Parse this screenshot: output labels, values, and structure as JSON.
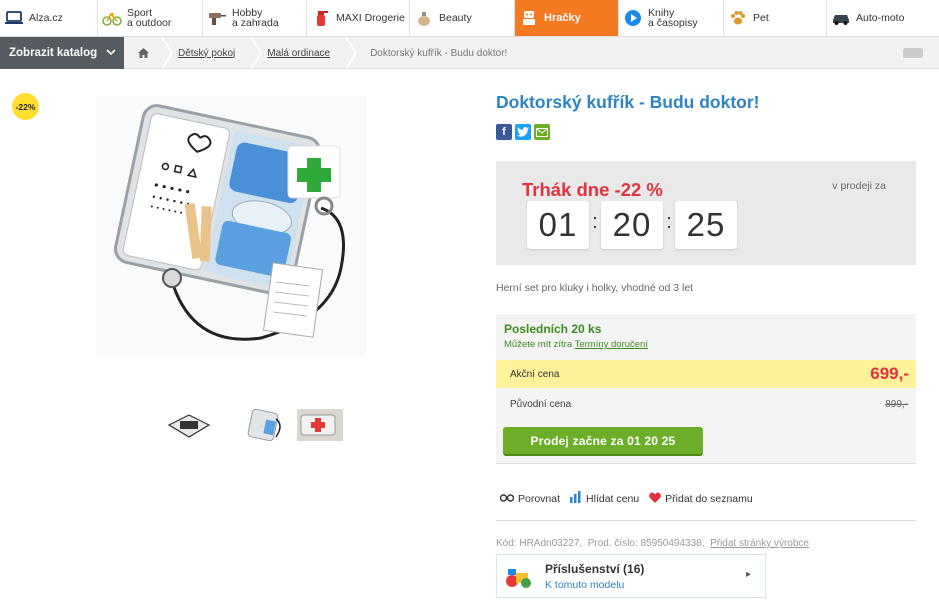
{
  "nav": {
    "categories": [
      {
        "label": "Alza.cz",
        "icon": "laptop-icon"
      },
      {
        "label": "Sport\na outdoor",
        "icon": "bicycle-icon"
      },
      {
        "label": "Hobby\na zahrada",
        "icon": "drill-icon"
      },
      {
        "label": "MAXI Drogerie",
        "icon": "spray-bottle-icon"
      },
      {
        "label": "Beauty",
        "icon": "perfume-icon"
      },
      {
        "label": "Hračky",
        "icon": "toy-robot-icon"
      },
      {
        "label": "Knihy\na časopisy",
        "icon": "play-icon"
      },
      {
        "label": "Pet",
        "icon": "paw-icon"
      },
      {
        "label": "Auto-moto",
        "icon": "car-icon"
      }
    ],
    "active_color": "#f47920"
  },
  "breadcrumb": {
    "catalog_button": "Zobrazit katalog",
    "items": [
      "Dětský pokoj",
      "Malá ordinace"
    ],
    "current": "Doktorský kufřík - Budu doktor!"
  },
  "product": {
    "discount_badge": "-22%",
    "title": "Doktorský kufřík - Budu doktor!",
    "description": "Herní set pro kluky i holky, vhodné od 3 let"
  },
  "deal": {
    "title": "Trhák dne -22 %",
    "on_sale_label": "v prodeji za",
    "hours": "01",
    "minutes": "20",
    "seconds": "25"
  },
  "stock": {
    "headline": "Posledních 20 ks",
    "delivery_text": "Můžete mít zítra",
    "delivery_link": "Termíny doručení"
  },
  "price": {
    "action_label": "Akční cena",
    "action_value": "699,-",
    "original_label": "Původní cena",
    "original_value": "899,-",
    "sale_button": "Prodej začne za 01 20 25"
  },
  "actions": {
    "compare": "Porovnat",
    "watch": "Hlídat cenu",
    "wishlist": "Přidat do seznamu"
  },
  "codes": {
    "kod": "Kód: HRAdn03227,",
    "prod": "Prod. číslo: 85950494338,",
    "link": "Přidat stránky výrobce"
  },
  "accessory": {
    "title": "Příslušenství (16)",
    "subtitle": "K tomuto modelu"
  },
  "colors": {
    "link_blue": "#2d83c4",
    "deal_red": "#e2333f",
    "stock_green": "#3a8c1c",
    "button_green": "#6cae28",
    "price_yellow": "#fff29a"
  }
}
